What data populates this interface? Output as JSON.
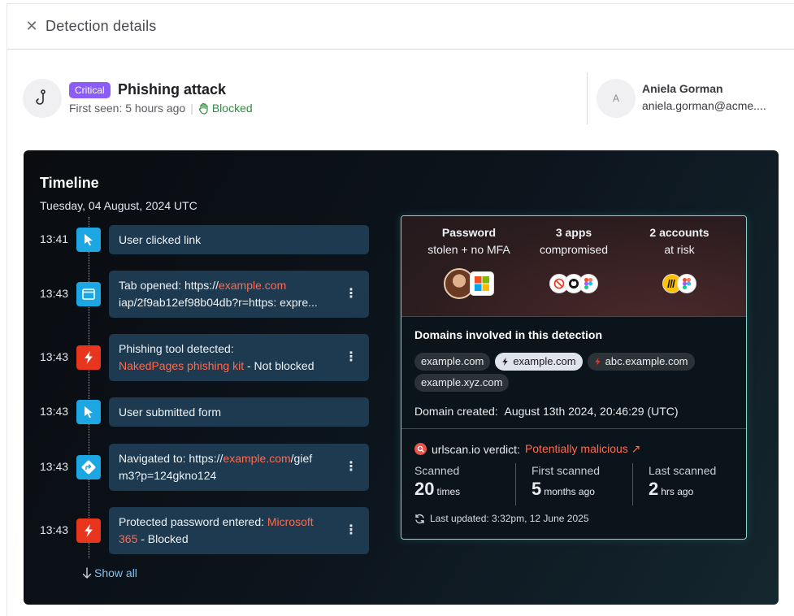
{
  "header": {
    "title": "Detection details"
  },
  "detection": {
    "severity": "Critical",
    "title": "Phishing attack",
    "first_seen": "First seen: 5 hours ago",
    "status": "Blocked"
  },
  "user": {
    "avatar_initial": "A",
    "name": "Aniela Gorman",
    "email": "aniela.gorman@acme...."
  },
  "timeline": {
    "title": "Timeline",
    "date": "Tuesday, 04 August, 2024 UTC",
    "show_all": "Show all",
    "events": [
      {
        "time": "13:41",
        "icon": "cursor-icon",
        "color": "#1ca7e3",
        "text": "User clicked link"
      },
      {
        "time": "13:43",
        "icon": "browser-tab-icon",
        "color": "#1ca7e3",
        "line1_prefix": "Tab opened: https://",
        "line1_link": "example.com",
        "line2": "iap/2f9ab12ef98b04db?r=https: expre..."
      },
      {
        "time": "13:43",
        "icon": "lightning-icon",
        "color": "#e8361e",
        "line1": "Phishing tool detected:",
        "line2_link": "NakedPages phishing kit",
        "line2_suffix": " - Not blocked"
      },
      {
        "time": "13:43",
        "icon": "cursor-icon",
        "color": "#1ca7e3",
        "text": "User submitted form"
      },
      {
        "time": "13:43",
        "icon": "navigate-icon",
        "color": "#1ca7e3",
        "line1_prefix": "Navigated to: https://",
        "line1_link": "example.com",
        "line1_suffix": "/gief",
        "line2": "m3?p=124gkno124"
      },
      {
        "time": "13:43",
        "icon": "lightning-icon",
        "color": "#e8361e",
        "line1_prefix": "Protected password entered: ",
        "line1_link": "Microsoft",
        "line2_link": "365",
        "line2_suffix": " - Blocked"
      }
    ]
  },
  "summary": {
    "stats": [
      {
        "bold": "Password",
        "sub": "stolen + no MFA"
      },
      {
        "bold": "3 apps",
        "sub": "compromised"
      },
      {
        "bold": "2 accounts",
        "sub": "at risk"
      }
    ],
    "domains_title": "Domains involved in this detection",
    "domains": [
      {
        "name": "example.com",
        "style": "dark",
        "icon": ""
      },
      {
        "name": "example.com",
        "style": "light",
        "icon": "lightning-icon"
      },
      {
        "name": "abc.example.com",
        "style": "dark",
        "icon": "lightning-red-icon"
      },
      {
        "name": "example.xyz.com",
        "style": "dark",
        "icon": ""
      }
    ],
    "domain_created_label": "Domain created:",
    "domain_created_value": "August 13th 2024, 20:46:29 (UTC)",
    "verdict_label": "urlscan.io verdict:",
    "verdict_value": "Potentially malicious",
    "scans": [
      {
        "label": "Scanned",
        "num": "20",
        "unit": "times"
      },
      {
        "label": "First scanned",
        "num": "5",
        "unit": "months ago"
      },
      {
        "label": "Last scanned",
        "num": "2",
        "unit": "hrs ago"
      }
    ],
    "last_updated": "Last updated: 3:32pm, 12 June 2025"
  },
  "colors": {
    "accent_purple": "#8b5cf6",
    "blocked_green": "#2e8b3e",
    "link_orange": "#ff6a4d",
    "event_blue": "#1ca7e3",
    "event_red": "#e8361e"
  }
}
